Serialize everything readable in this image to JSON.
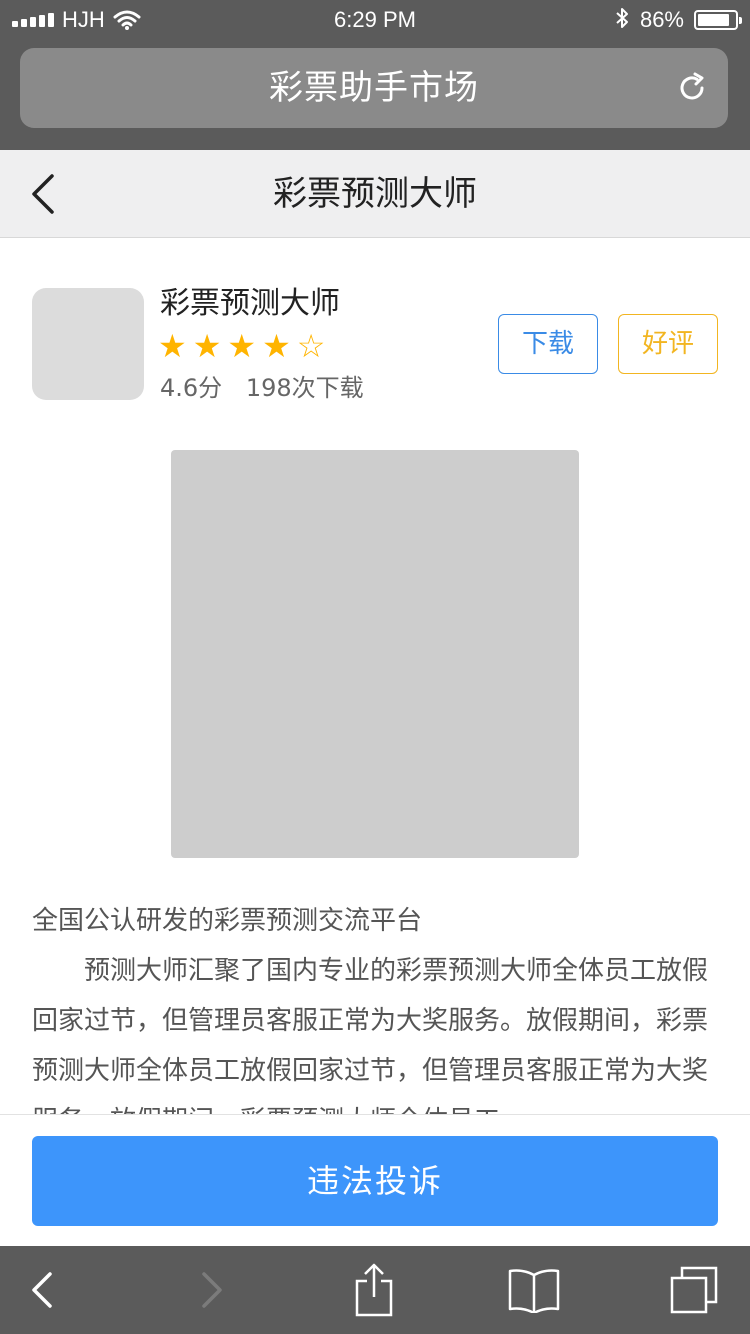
{
  "status_bar": {
    "carrier": "HJH",
    "time": "6:29 PM",
    "battery_percent": "86%",
    "battery_level": 0.86,
    "icons": [
      "signal-icon",
      "wifi-icon",
      "bluetooth-icon",
      "battery-icon"
    ]
  },
  "browser": {
    "address_title": "彩票助手市场",
    "reload_icon": "reload-icon"
  },
  "nav": {
    "back_icon": "back-chevron-icon",
    "title": "彩票预测大师"
  },
  "app": {
    "name": "彩票预测大师",
    "rating_stars": 4,
    "rating_max": 5,
    "score": "4.6分",
    "downloads": "198次下载",
    "download_button": "下载",
    "rate_button": "好评",
    "colors": {
      "star": "#ffb400",
      "download": "#3a8be6",
      "rate": "#f2b521"
    }
  },
  "description": {
    "title": "全国公认研发的彩票预测交流平台",
    "body": "预测大师汇聚了国内专业的彩票预测大师全体员工放假回家过节，但管理员客服正常为大奖服务。放假期间，彩票预测大师全体员工放假回家过节，但管理员客服正常为大奖服务。放假期间，彩票预测大师全体员工"
  },
  "complaint_button": "违法投诉",
  "toolbar": {
    "icons": [
      "back-icon",
      "forward-icon",
      "share-icon",
      "bookmarks-icon",
      "tabs-icon"
    ]
  },
  "colors": {
    "chrome": "#5b5b5b",
    "primary_button": "#3d95fb"
  }
}
